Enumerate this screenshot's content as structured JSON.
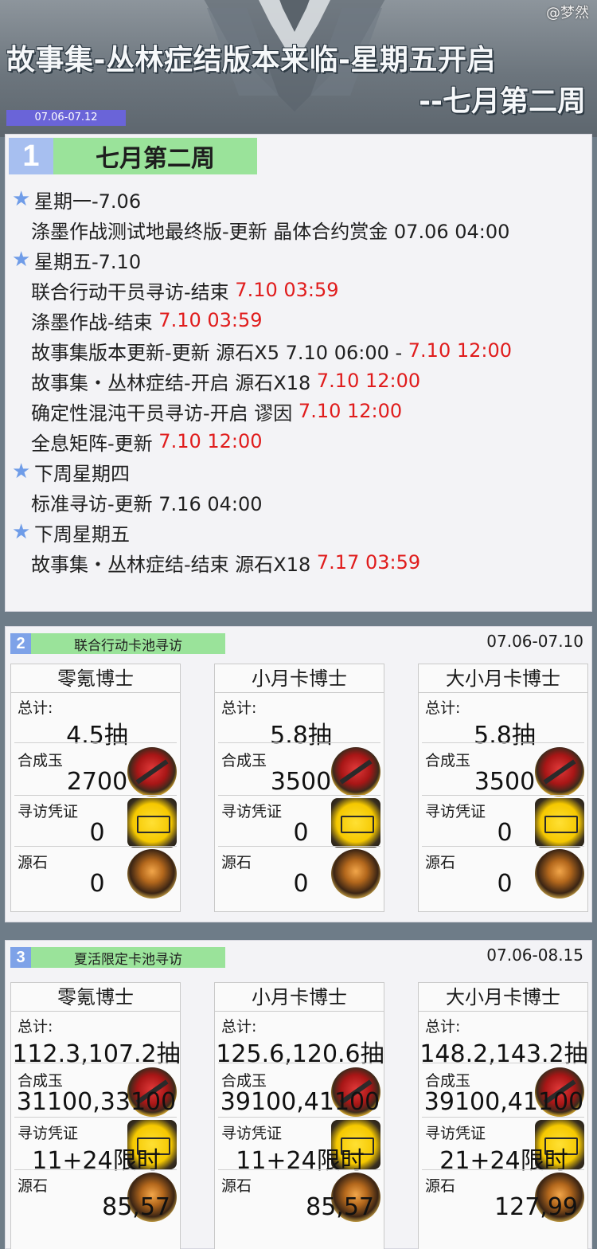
{
  "header": {
    "watermark": "@梦然",
    "title_line1": "故事集-丛林症结版本来临-星期五开启",
    "title_line2": "--七月第二周",
    "date_tag": "07.06-07.12"
  },
  "section1": {
    "number": "1",
    "title": "七月第二周",
    "days": [
      {
        "label": "星期一-7.06",
        "events": [
          {
            "text": "涤墨作战测试地最终版-更新 晶体合约赏金 07.06 04:00",
            "red": ""
          }
        ]
      },
      {
        "label": "星期五-7.10",
        "events": [
          {
            "text": "联合行动干员寻访-结束 ",
            "red": "7.10 03:59"
          },
          {
            "text": "涤墨作战-结束 ",
            "red": "7.10 03:59"
          },
          {
            "text": "故事集版本更新-更新 源石X5 7.10 06:00 - ",
            "red": "7.10 12:00"
          },
          {
            "text": "故事集・丛林症结-开启 源石X18 ",
            "red": "7.10 12:00"
          },
          {
            "text": "确定性混沌干员寻访-开启 谬因 ",
            "red": "7.10 12:00"
          },
          {
            "text": "全息矩阵-更新 ",
            "red": "7.10 12:00"
          }
        ]
      },
      {
        "label": "下周星期四",
        "events": [
          {
            "text": "标准寻访-更新 7.16 04:00",
            "red": ""
          }
        ]
      },
      {
        "label": "下周星期五",
        "events": [
          {
            "text": "故事集・丛林症结-结束 源石X18 ",
            "red": "7.17 03:59"
          }
        ]
      }
    ]
  },
  "section2": {
    "number": "2",
    "title": "联合行动卡池寻访",
    "date": "07.06-07.10",
    "cards": [
      {
        "name": "零氪博士",
        "total_label": "总计:",
        "total": "4.5抽",
        "orundum_label": "合成玉",
        "orundum": "2700",
        "ticket_label": "寻访凭证",
        "ticket": "0",
        "prime_label": "源石",
        "prime": "0"
      },
      {
        "name": "小月卡博士",
        "total_label": "总计:",
        "total": "5.8抽",
        "orundum_label": "合成玉",
        "orundum": "3500",
        "ticket_label": "寻访凭证",
        "ticket": "0",
        "prime_label": "源石",
        "prime": "0"
      },
      {
        "name": "大小月卡博士",
        "total_label": "总计:",
        "total": "5.8抽",
        "orundum_label": "合成玉",
        "orundum": "3500",
        "ticket_label": "寻访凭证",
        "ticket": "0",
        "prime_label": "源石",
        "prime": "0"
      }
    ]
  },
  "section3": {
    "number": "3",
    "title": "夏活限定卡池寻访",
    "date": "07.06-08.15",
    "cards": [
      {
        "name": "零氪博士",
        "total_label": "总计:",
        "total": "112.3,107.2抽",
        "orundum_label": "合成玉",
        "orundum": "31100,33100",
        "ticket_label": "寻访凭证",
        "ticket": "11+24限时",
        "prime_label": "源石",
        "prime": "85,57"
      },
      {
        "name": "小月卡博士",
        "total_label": "总计:",
        "total": "125.6,120.6抽",
        "orundum_label": "合成玉",
        "orundum": "39100,41100",
        "ticket_label": "寻访凭证",
        "ticket": "11+24限时",
        "prime_label": "源石",
        "prime": "85,57"
      },
      {
        "name": "大小月卡博士",
        "total_label": "总计:",
        "total": "148.2,143.2抽",
        "orundum_label": "合成玉",
        "orundum": "39100,41100",
        "ticket_label": "寻访凭证",
        "ticket": "21+24限时",
        "prime_label": "源石",
        "prime": "127,99"
      }
    ]
  },
  "icons": {
    "star": "star-icon",
    "orundum": "orundum-icon",
    "ticket": "headhunting-permit-icon",
    "prime": "originite-prime-icon"
  },
  "colors": {
    "accent_red": "#e01c1c",
    "section_green": "#9ae39a",
    "section_blue": "#a7bff0",
    "date_tag": "#6a64d8"
  }
}
